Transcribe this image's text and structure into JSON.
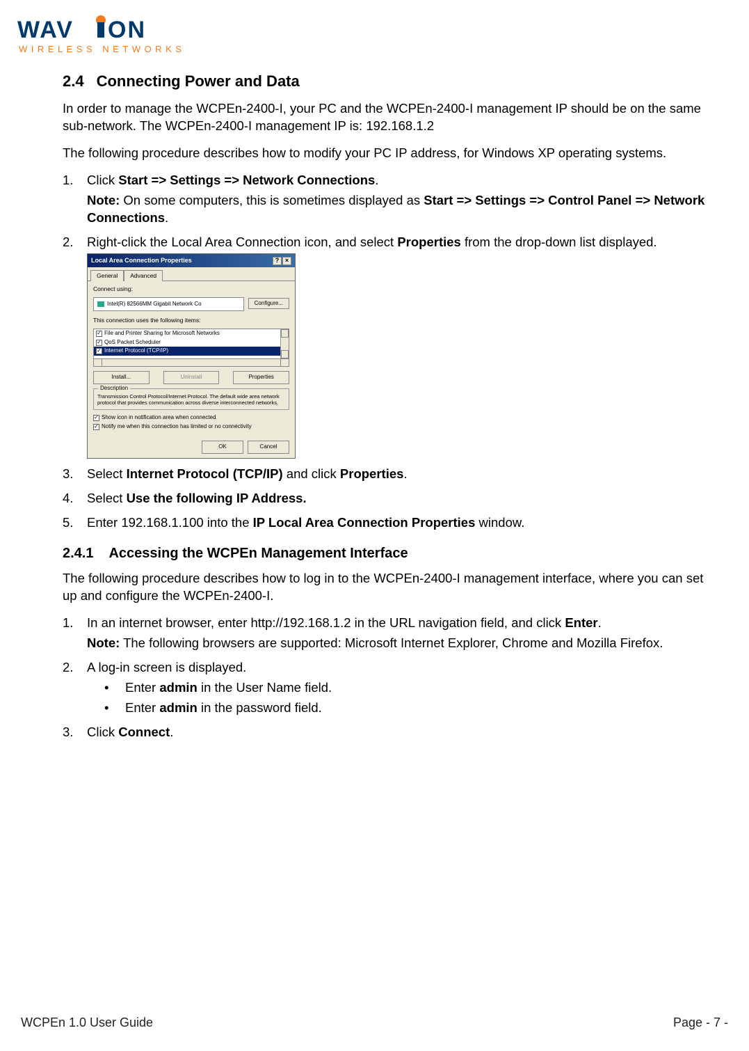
{
  "logo": {
    "brand": "WAVION",
    "tagline": "WIRELESS NETWORKS"
  },
  "h2": {
    "num": "2.4",
    "title": "Connecting Power and Data"
  },
  "p1": "In order to manage the WCPEn-2400-I, your PC and the WCPEn-2400-I management IP should be on the same sub-network. The WCPEn-2400-I management IP is: 192.168.1.2",
  "p2": "The following procedure describes how to modify your PC IP address, for Windows XP operating systems.",
  "ol1": {
    "i1a": "Click ",
    "i1b": "Start => Settings => Network Connections",
    "i1c": ".",
    "i1n1": "Note:",
    "i1n2": " On some computers, this is sometimes displayed as ",
    "i1n3": "Start => Settings => Control Panel => Network Connections",
    "i1n4": ".",
    "i2a": "Right-click the Local Area Connection icon, and select ",
    "i2b": "Properties",
    "i2c": " from the drop-down list displayed.",
    "i3a": "Select ",
    "i3b": "Internet Protocol (TCP/IP)",
    "i3c": " and click ",
    "i3d": "Properties",
    "i3e": ".",
    "i4a": "Select ",
    "i4b": "Use the following IP Address.",
    "i5a": "Enter 192.168.1.100 into the ",
    "i5b": "IP Local Area Connection Properties",
    "i5c": " window."
  },
  "dialog": {
    "title": "Local Area Connection Properties",
    "tab1": "General",
    "tab2": "Advanced",
    "connect_label": "Connect using:",
    "nic": "Intel(R) 82566MM Gigabit Network Co",
    "configure": "Configure...",
    "uses_label": "This connection uses the following items:",
    "item1": "File and Printer Sharing for Microsoft Networks",
    "item2": "QoS Packet Scheduler",
    "item3": "Internet Protocol (TCP/IP)",
    "install": "Install...",
    "uninstall": "Uninstall",
    "properties": "Properties",
    "desc_title": "Description",
    "desc": "Transmission Control Protocol/Internet Protocol. The default wide area network protocol that provides communication across diverse interconnected networks.",
    "chk1": "Show icon in notification area when connected",
    "chk2": "Notify me when this connection has limited or no connectivity",
    "ok": "OK",
    "cancel": "Cancel"
  },
  "h3": {
    "num": "2.4.1",
    "title": "Accessing the WCPEn Management Interface"
  },
  "p3": "The following procedure describes how to log in to the WCPEn-2400-I management interface, where you can set up and configure the WCPEn-2400-I.",
  "ol2": {
    "i1a": "In an internet browser, enter http://192.168.1.2 in the URL navigation field, and click ",
    "i1b": "Enter",
    "i1c": ".",
    "i1n1": "Note:",
    "i1n2": " The following browsers are supported: Microsoft Internet Explorer, Chrome and Mozilla Firefox.",
    "i2": "A log-in screen is displayed.",
    "b1a": "Enter ",
    "b1b": "admin",
    "b1c": " in the User Name field.",
    "b2a": "Enter ",
    "b2b": "admin",
    "b2c": " in the password field.",
    "i3a": "Click ",
    "i3b": "Connect",
    "i3c": "."
  },
  "footer": {
    "left": "WCPEn 1.0 User Guide",
    "right": "Page - 7 -"
  }
}
